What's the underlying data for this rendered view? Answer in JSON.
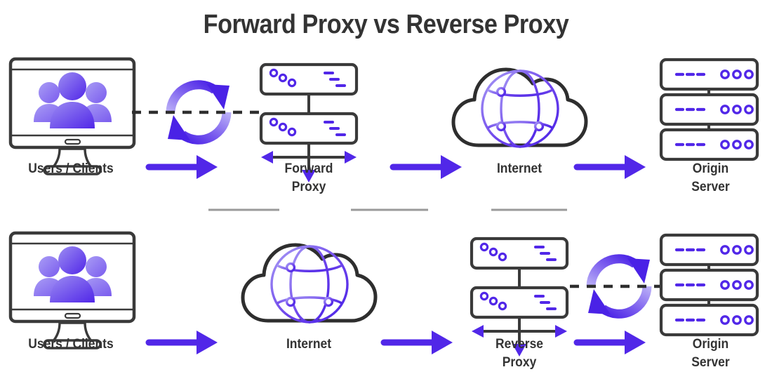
{
  "page": {
    "title": "Forward Proxy vs Reverse Proxy",
    "background_color": "#ffffff",
    "title_color": "#333333",
    "accent_purple": "#5127e8",
    "light_purple": "#9b8cef",
    "outline_dark": "#3a3a3a",
    "divider_gray": "#9a9a9a"
  },
  "rows": [
    {
      "id": "forward-proxy-row",
      "name": "Forward Proxy flow",
      "nodes": [
        {
          "id": "users-clients",
          "label": "Users / Clients",
          "icon": "monitor-users-icon"
        },
        {
          "id": "forward-proxy",
          "label": "Forward\nProxy",
          "label_line1": "Forward",
          "label_line2": "Proxy",
          "icon": "proxy-server-icon"
        },
        {
          "id": "internet",
          "label": "Internet",
          "icon": "cloud-globe-icon"
        },
        {
          "id": "origin-server",
          "label": "Origin\nServer",
          "label_line1": "Origin",
          "label_line2": "Server",
          "icon": "server-rack-icon"
        }
      ],
      "connectors": [
        {
          "id": "users-to-forward-proxy",
          "type": "arrow-right"
        },
        {
          "id": "forward-proxy-to-internet",
          "type": "arrow-right"
        },
        {
          "id": "internet-to-origin-server",
          "type": "arrow-right"
        },
        {
          "id": "users-forward-proxy-sync",
          "type": "sync-circular-arrows-with-dashed-line"
        }
      ]
    },
    {
      "id": "reverse-proxy-row",
      "name": "Reverse Proxy flow",
      "nodes": [
        {
          "id": "users-clients",
          "label": "Users / Clients",
          "icon": "monitor-users-icon"
        },
        {
          "id": "internet",
          "label": "Internet",
          "icon": "cloud-globe-icon"
        },
        {
          "id": "reverse-proxy",
          "label": "Reverse\nProxy",
          "label_line1": "Reverse",
          "label_line2": "Proxy",
          "icon": "proxy-server-icon"
        },
        {
          "id": "origin-server",
          "label": "Origin\nServer",
          "label_line1": "Origin",
          "label_line2": "Server",
          "icon": "server-rack-icon"
        }
      ],
      "connectors": [
        {
          "id": "users-to-internet",
          "type": "arrow-right"
        },
        {
          "id": "internet-to-reverse-proxy",
          "type": "arrow-right"
        },
        {
          "id": "reverse-proxy-to-origin-server",
          "type": "arrow-right"
        },
        {
          "id": "reverse-proxy-origin-sync",
          "type": "sync-circular-arrows-with-dashed-line"
        }
      ]
    }
  ],
  "dividers": [
    {
      "id": "divider-1"
    },
    {
      "id": "divider-2"
    },
    {
      "id": "divider-3"
    }
  ],
  "labels": {
    "users_clients": "Users / Clients",
    "forward_proxy_line1": "Forward",
    "forward_proxy_line2": "Proxy",
    "reverse_proxy_line1": "Reverse",
    "reverse_proxy_line2": "Proxy",
    "internet": "Internet",
    "origin_server_line1": "Origin",
    "origin_server_line2": "Server"
  }
}
